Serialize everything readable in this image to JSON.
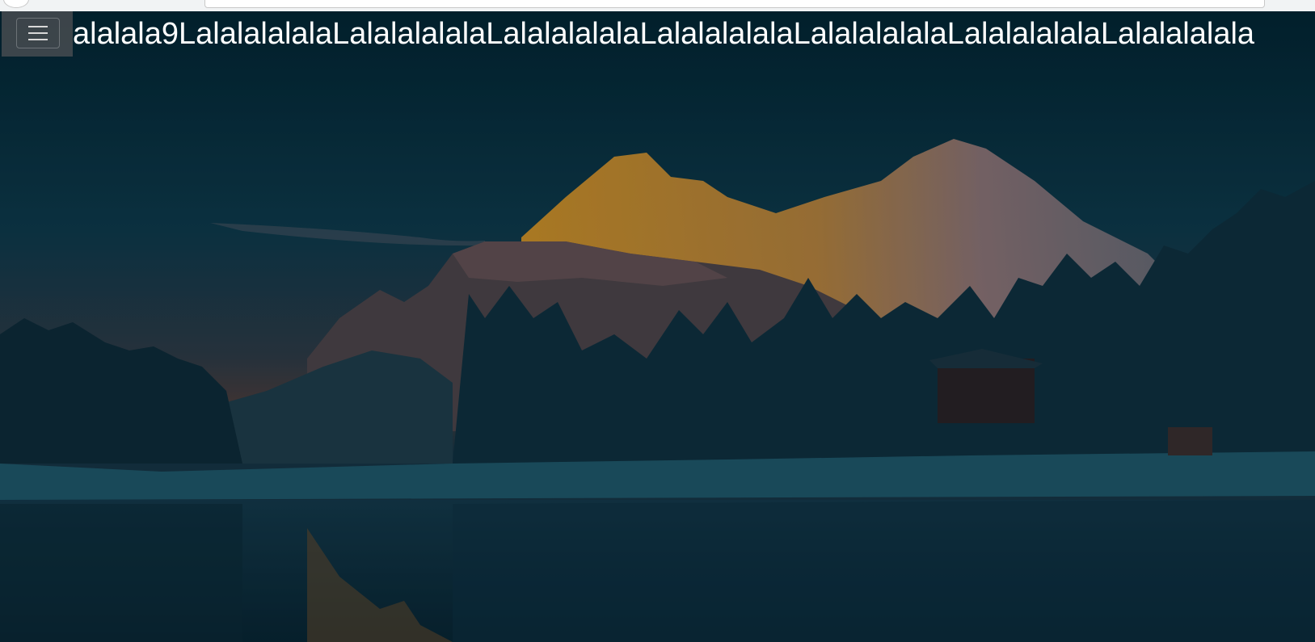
{
  "navbar": {
    "menu_toggle_icon": "hamburger-icon",
    "headline": "alalala9LalalalalalaLalalalalalaLalalalalalaLalalalalalaLalalalalalaLalalalalalaLalalalalala"
  },
  "background": {
    "description_colors": {
      "sky_top": "#01232f",
      "sky_mid": "#0d3a4a",
      "horizon": "#3d3a3d",
      "peaks_lit": "#e3a12a",
      "snow": "#1e5869",
      "water": "#0b2632"
    }
  }
}
